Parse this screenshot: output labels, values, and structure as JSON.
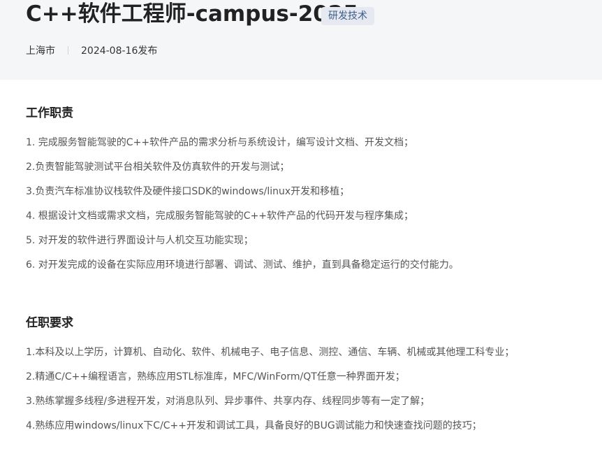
{
  "job": {
    "title": "C++软件工程师-campus-2025",
    "category": "研发技术",
    "location": "上海市",
    "published": "2024-08-16发布"
  },
  "responsibilities": {
    "heading": "工作职责",
    "items": [
      "1. 完成服务智能驾驶的C++软件产品的需求分析与系统设计，编写设计文档、开发文档；",
      "2.负责智能驾驶测试平台相关软件及仿真软件的开发与测试；",
      "3.负责汽车标准协议栈软件及硬件接口SDK的windows/linux开发和移植；",
      "4. 根据设计文档或需求文档，完成服务智能驾驶的C++软件产品的代码开发与程序集成；",
      "5. 对开发的软件进行界面设计与人机交互功能实现；",
      "6. 对开发完成的设备在实际应用环境进行部署、调试、测试、维护，直到具备稳定运行的交付能力。"
    ]
  },
  "requirements": {
    "heading": "任职要求",
    "items": [
      "1.本科及以上学历，计算机、自动化、软件、机械电子、电子信息、测控、通信、车辆、机械或其他理工科专业；",
      "2.精通C/C++编程语言，熟练应用STL标准库，MFC/WinForm/QT任意一种界面开发；",
      "3.熟练掌握多线程/多进程开发，对消息队列、异步事件、共享内存、线程同步等有一定了解；",
      "4.熟练应用windows/linux下C/C++开发和调试工具，具备良好的BUG调试能力和快速查找问题的技巧；"
    ]
  }
}
